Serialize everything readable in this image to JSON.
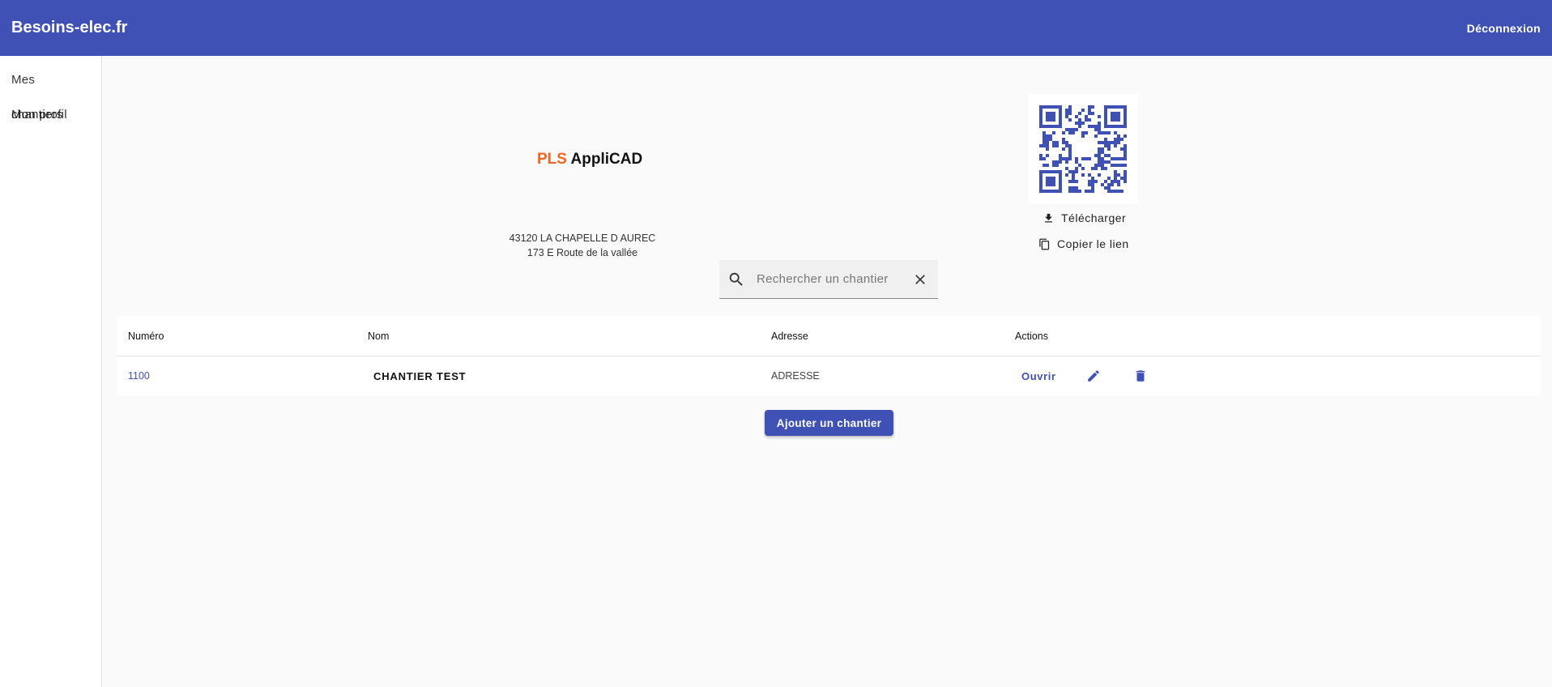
{
  "header": {
    "brand": "Besoins-elec.fr",
    "logout_label": "Déconnexion"
  },
  "sidebar": {
    "items": [
      {
        "label": "Mes chantiers"
      },
      {
        "label": "Mon profil"
      }
    ]
  },
  "company": {
    "logo_part1": "PLS",
    "logo_part2": "AppliCAD",
    "address_line1": "43120 LA CHAPELLE D AUREC",
    "address_line2": "173 E Route de la vallée"
  },
  "qr": {
    "download_label": "Télécharger",
    "copy_label": "Copier le lien",
    "color": "#3f51b5"
  },
  "search": {
    "placeholder": "Rechercher un chantier",
    "value": ""
  },
  "table": {
    "headers": [
      "Numéro",
      "Nom",
      "Adresse",
      "Actions"
    ],
    "rows": [
      {
        "numero": "1100",
        "nom": "CHANTIER TEST",
        "adresse": "ADRESSE",
        "open_label": "Ouvrir"
      }
    ]
  },
  "add_button_label": "Ajouter un chantier",
  "colors": {
    "primary": "#3f51b5",
    "logo_accent": "#f26522"
  }
}
